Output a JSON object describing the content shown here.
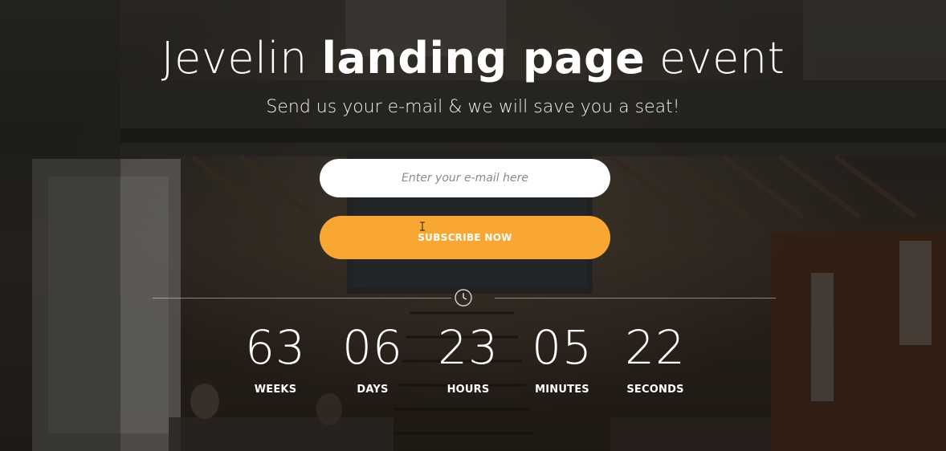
{
  "hero": {
    "title_light_1": "Jevelin ",
    "title_bold": "landing page",
    "title_light_2": " event",
    "subtitle": "Send us your e-mail & we will save you a seat!"
  },
  "form": {
    "email_placeholder": "Enter your e-mail here",
    "email_value": "",
    "subscribe_label": "SUBSCRIBE NOW",
    "accent_color": "#f9a733"
  },
  "divider": {
    "icon": "clock-icon"
  },
  "countdown": {
    "weeks": {
      "value": "63",
      "label": "WEEKS"
    },
    "days": {
      "value": "06",
      "label": "DAYS"
    },
    "hours": {
      "value": "23",
      "label": "HOURS"
    },
    "minutes": {
      "value": "05",
      "label": "MINUTES"
    },
    "seconds": {
      "value": "22",
      "label": "SECONDS"
    }
  }
}
